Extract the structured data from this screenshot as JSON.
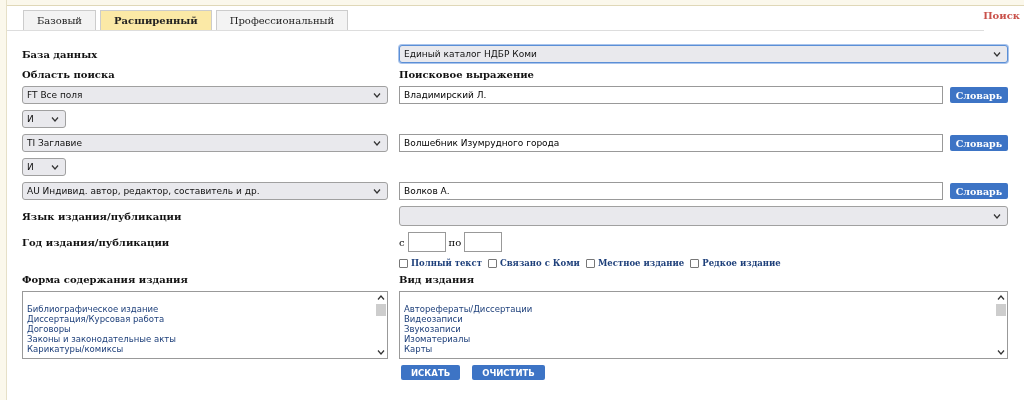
{
  "header_link": "Поиск",
  "tabs": [
    {
      "label": "Базовый",
      "selected": false
    },
    {
      "label": "Расширенный",
      "selected": true
    },
    {
      "label": "Профессиональный",
      "selected": false
    }
  ],
  "database": {
    "label": "База данных",
    "value": "Единый каталог НДБР Коми",
    "focused": true
  },
  "search_area_label": "Область поиска",
  "search_expression_label": "Поисковое выражение",
  "criteria": [
    {
      "field": "FT Все поля",
      "value": "Владимирский Л.",
      "button": "Словарь",
      "operator": "И"
    },
    {
      "field": "TI Заглавие",
      "value": "Волшебник Изумрудного города",
      "button": "Словарь",
      "operator": "И"
    },
    {
      "field": "AU Индивид. автор, редактор, составитель и др.",
      "value": "Волков А.",
      "button": "Словарь"
    }
  ],
  "language": {
    "label": "Язык издания/публикации"
  },
  "year": {
    "label": "Год издания/публикации",
    "from_label": "с",
    "to_label": "по"
  },
  "flags": [
    {
      "label": "Полный текст",
      "checked": false
    },
    {
      "label": "Связано с Коми",
      "checked": false
    },
    {
      "label": "Местное издание",
      "checked": false
    },
    {
      "label": "Редкое издание",
      "checked": false
    }
  ],
  "content_form": {
    "label": "Форма содержания издания",
    "items": [
      "Библиографическое издание",
      "Диссертация/Курсовая работа",
      "Договоры",
      "Законы и законодательные акты",
      "Карикатуры/комиксы"
    ]
  },
  "publication_type": {
    "label": "Вид издания",
    "items": [
      "Авторефераты/Диссертации",
      "Видеозаписи",
      "Звукозаписи",
      "Изоматериалы",
      "Карты"
    ]
  },
  "buttons": [
    "ИСКАТЬ",
    "ОЧИСТИТЬ"
  ]
}
